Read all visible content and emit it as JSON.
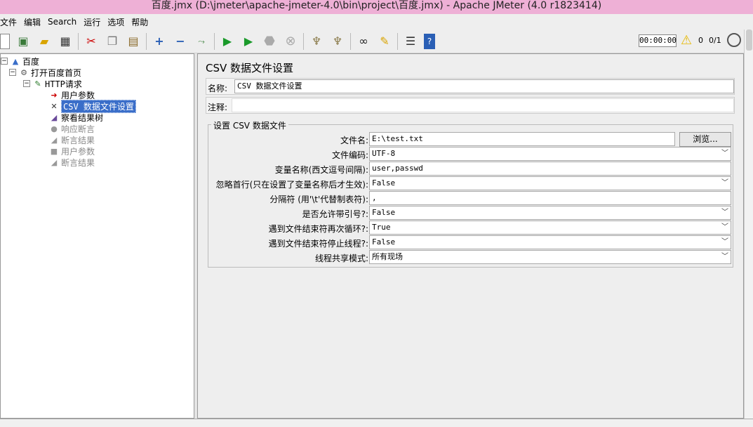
{
  "window": {
    "title": "百度.jmx (D:\\jmeter\\apache-jmeter-4.0\\bin\\project\\百度.jmx) - Apache JMeter (4.0 r1823414)"
  },
  "menu": [
    "文件",
    "编辑",
    "Search",
    "运行",
    "选项",
    "帮助"
  ],
  "toolbar": {
    "timer": "00:00:00",
    "warning_count": "0",
    "threads": "0/1"
  },
  "tree": {
    "root": "百度",
    "thread_group": "打开百度首页",
    "http_request": "HTTP请求",
    "user_params": "用户参数",
    "csv_config": "CSV 数据文件设置",
    "result_tree": "察看结果树",
    "response_assert": "响应断言",
    "assert_result_1": "断言结果",
    "user_params_2": "用户参数",
    "assert_result_2": "断言结果"
  },
  "panel": {
    "title": "CSV 数据文件设置",
    "name_label": "名称:",
    "name_value": "CSV 数据文件设置",
    "comment_label": "注释:",
    "comment_value": "",
    "group_title": "设置 CSV 数据文件",
    "browse_label": "浏览...",
    "fields": [
      {
        "label": "文件名:",
        "value": "E:\\test.txt"
      },
      {
        "label": "文件编码:",
        "value": "UTF-8"
      },
      {
        "label": "变量名称(西文逗号间隔):",
        "value": "user,passwd"
      },
      {
        "label": "忽略首行(只在设置了变量名称后才生效):",
        "value": "False"
      },
      {
        "label": "分隔符 (用'\\t'代替制表符):",
        "value": ","
      },
      {
        "label": "是否允许带引号?:",
        "value": "False"
      },
      {
        "label": "遇到文件结束符再次循环?:",
        "value": "True"
      },
      {
        "label": "遇到文件结束符停止线程?:",
        "value": "False"
      },
      {
        "label": "线程共享模式:",
        "value": "所有现场"
      }
    ]
  },
  "icons": {
    "new": "new-file-icon",
    "templates": "templates-icon",
    "open": "open-folder-icon",
    "save": "save-icon",
    "cut": "cut-icon",
    "copy": "copy-icon",
    "paste": "paste-icon",
    "expand": "plus-icon",
    "collapse": "minus-icon",
    "toggle": "toggle-icon",
    "start": "play-icon",
    "start_no_pause": "play-no-pause-icon",
    "stop": "stop-icon",
    "shutdown": "shutdown-icon",
    "clear": "clear-icon",
    "clear_all": "clear-all-icon",
    "search": "binoculars-icon",
    "reset": "broom-icon",
    "functions": "function-list-icon",
    "help": "help-icon"
  }
}
